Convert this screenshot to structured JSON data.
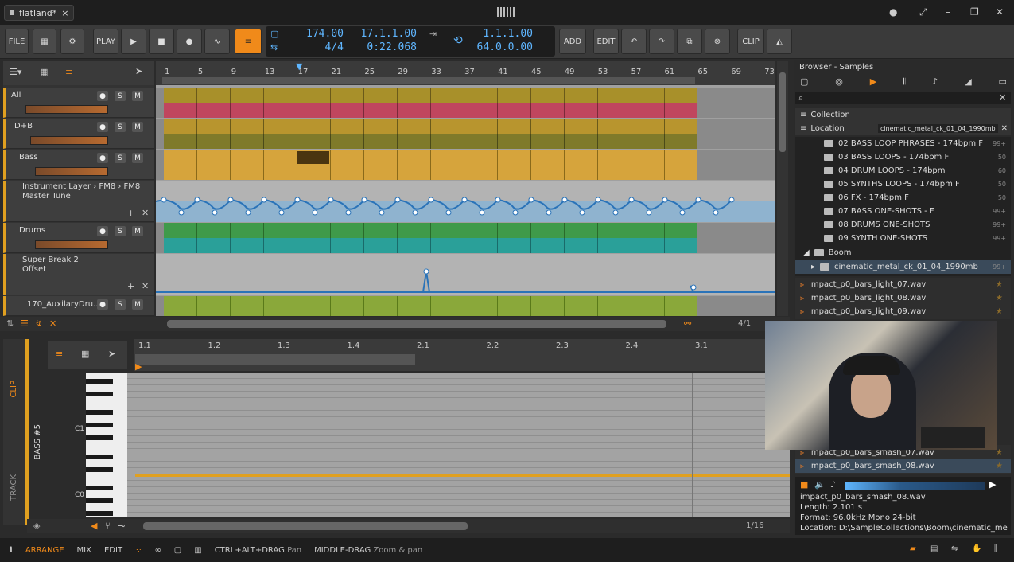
{
  "window": {
    "tab_title": "flatland*",
    "close": "×"
  },
  "toolbar": {
    "file": "FILE",
    "play_label": "PLAY",
    "add": "ADD",
    "edit": "EDIT",
    "clip": "CLIP"
  },
  "transport": {
    "tempo": "174.00",
    "meter": "4/4",
    "position": "17.1.1.00",
    "time": "0:22.068",
    "loop_start": "1.1.1.00",
    "loop_length": "64.0.0.00"
  },
  "ruler": [
    "1",
    "5",
    "9",
    "13",
    "17",
    "21",
    "25",
    "29",
    "33",
    "37",
    "41",
    "45",
    "49",
    "53",
    "57",
    "61",
    "65",
    "69",
    "73"
  ],
  "tracks": [
    {
      "name": "All"
    },
    {
      "name": "D+B"
    },
    {
      "name": "Bass"
    },
    {
      "name": "Instrument Layer › FM8 › FM8",
      "sub": "Master Tune"
    },
    {
      "name": "Drums"
    },
    {
      "name": "Super Break 2",
      "sub": "Offset"
    },
    {
      "name": "170_AuxilaryDru..."
    }
  ],
  "arranger": {
    "zoom": "4/1"
  },
  "browser": {
    "title": "Browser - Samples",
    "collection": "Collection",
    "location": "Location",
    "location_value": "cinematic_metal_ck_01_04_1990mb",
    "folders": [
      {
        "name": "02 BASS LOOP PHRASES - 174bpm F",
        "count": "99+"
      },
      {
        "name": "03 BASS LOOPS - 174bpm F",
        "count": "50"
      },
      {
        "name": "04 DRUM LOOPS - 174bpm",
        "count": "60"
      },
      {
        "name": "05 SYNTHS LOOPS - 174bpm F",
        "count": "50"
      },
      {
        "name": "06 FX - 174bpm F",
        "count": "50"
      },
      {
        "name": "07 BASS ONE-SHOTS - F",
        "count": "99+"
      },
      {
        "name": "08 DRUMS ONE-SHOTS",
        "count": "99+"
      },
      {
        "name": "09 SYNTH ONE-SHOTS",
        "count": "99+"
      },
      {
        "name": "Boom",
        "count": ""
      },
      {
        "name": "cinematic_metal_ck_01_04_1990mb",
        "count": "99+"
      }
    ],
    "files": [
      "impact_p0_bars_light_07.wav",
      "impact_p0_bars_light_08.wav",
      "impact_p0_bars_light_09.wav"
    ],
    "files_bottom": [
      "impact_p0_bars_smash_07.wav",
      "impact_p0_bars_smash_08.wav"
    ],
    "preview": {
      "name": "impact_p0_bars_smash_08.wav",
      "length": "Length: 2.101 s",
      "format": "Format: 96.0kHz Mono 24-bit",
      "location": "Location: D:\\SampleCollections\\Boom\\cinematic_metal_ck..."
    }
  },
  "editor": {
    "ruler": [
      "1.1",
      "1.2",
      "1.3",
      "1.4",
      "2.1",
      "2.2",
      "2.3",
      "2.4",
      "3.1"
    ],
    "track_name": "BASS #5",
    "clip_tab": "CLIP",
    "track_tab": "TRACK",
    "c1": "C1",
    "c0": "C0",
    "zoom": "1/16"
  },
  "status": {
    "arrange": "ARRANGE",
    "mix": "MIX",
    "edit": "EDIT",
    "hint1_key": "CTRL+ALT+DRAG",
    "hint1_action": "Pan",
    "hint2_key": "MIDDLE-DRAG",
    "hint2_action": "Zoom & pan"
  },
  "colors": {
    "accent": "#f08a1a",
    "lcd": "#5fb6ff",
    "clip_gold": "#c8a23a",
    "clip_green": "#3f9a4a"
  }
}
